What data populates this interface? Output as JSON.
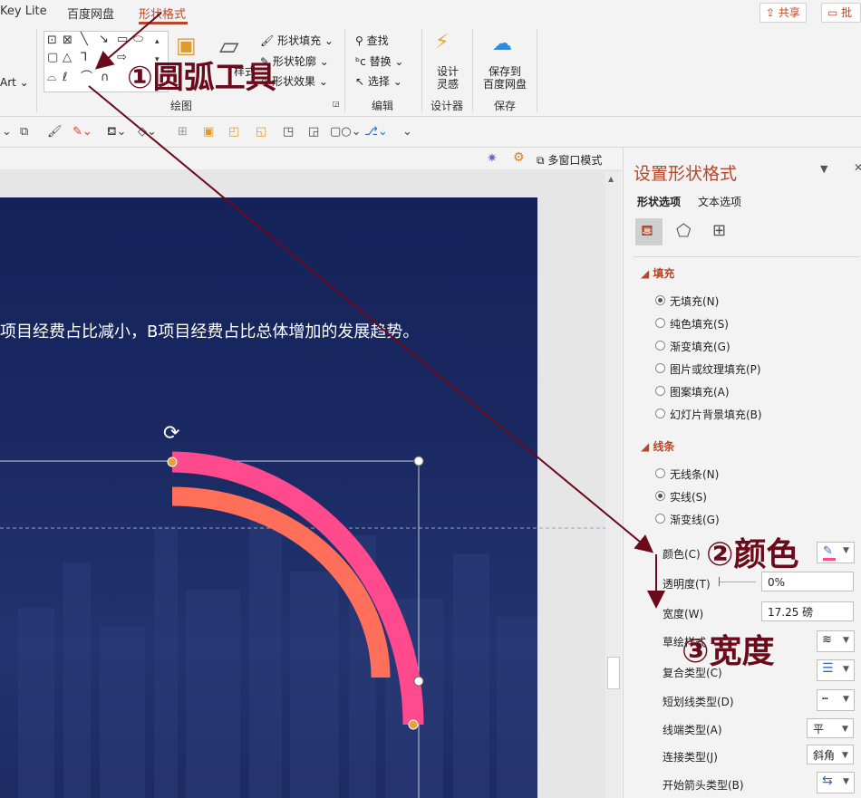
{
  "tabs": {
    "app": "Key Lite",
    "baidu": "百度网盘",
    "shape_format": "形状格式"
  },
  "top_buttons": {
    "share": "共享",
    "comment": "批注"
  },
  "ribbon": {
    "art_label": "Art",
    "shape_fill": "形状填充",
    "shape_outline": "形状轮廓",
    "shape_effects": "形状效果",
    "style_label": "样式",
    "drawing_group": "绘图",
    "find": "查找",
    "replace": "替换",
    "select": "选择",
    "edit_group": "编辑",
    "design_ideas": "设计\n灵感",
    "design_ideas_1": "设计",
    "design_ideas_2": "灵感",
    "designer_group": "设计器",
    "save_to_baidu_1": "保存到",
    "save_to_baidu_2": "百度网盘",
    "save_group": "保存"
  },
  "view": {
    "multiwindow": "多窗口模式"
  },
  "slide": {
    "text": "项目经费占比减小，B项目经费占比总体增加的发展趋势。"
  },
  "pane": {
    "title": "设置形状格式",
    "tab_shape": "形状选项",
    "tab_text": "文本选项",
    "fill_head": "填充",
    "fill_options": [
      "无填充(N)",
      "纯色填充(S)",
      "渐变填充(G)",
      "图片或纹理填充(P)",
      "图案填充(A)",
      "幻灯片背景填充(B)"
    ],
    "fill_selected": 0,
    "line_head": "线条",
    "line_options": [
      "无线条(N)",
      "实线(S)",
      "渐变线(G)"
    ],
    "line_selected": 1,
    "color_label": "颜色(C)",
    "transparency_label": "透明度(T)",
    "transparency_value": "0%",
    "width_label": "宽度(W)",
    "width_value": "17.25 磅",
    "sketch_label": "草绘样式",
    "compound_label": "复合类型(C)",
    "dash_label": "短划线类型(D)",
    "cap_label": "线端类型(A)",
    "cap_value": "平",
    "join_label": "连接类型(J)",
    "join_value": "斜角",
    "arrow_label": "开始箭头类型(B)"
  },
  "annotations": {
    "a1": "①圆弧工具",
    "a2": "②颜色",
    "a3": "③宽度"
  },
  "colors": {
    "accent": "#b7472a",
    "arc_outer": "#ff4a8d",
    "arc_inner": "#ff6f5a",
    "annot": "#6b0a1a",
    "slide_bg": "#1b2a63"
  }
}
